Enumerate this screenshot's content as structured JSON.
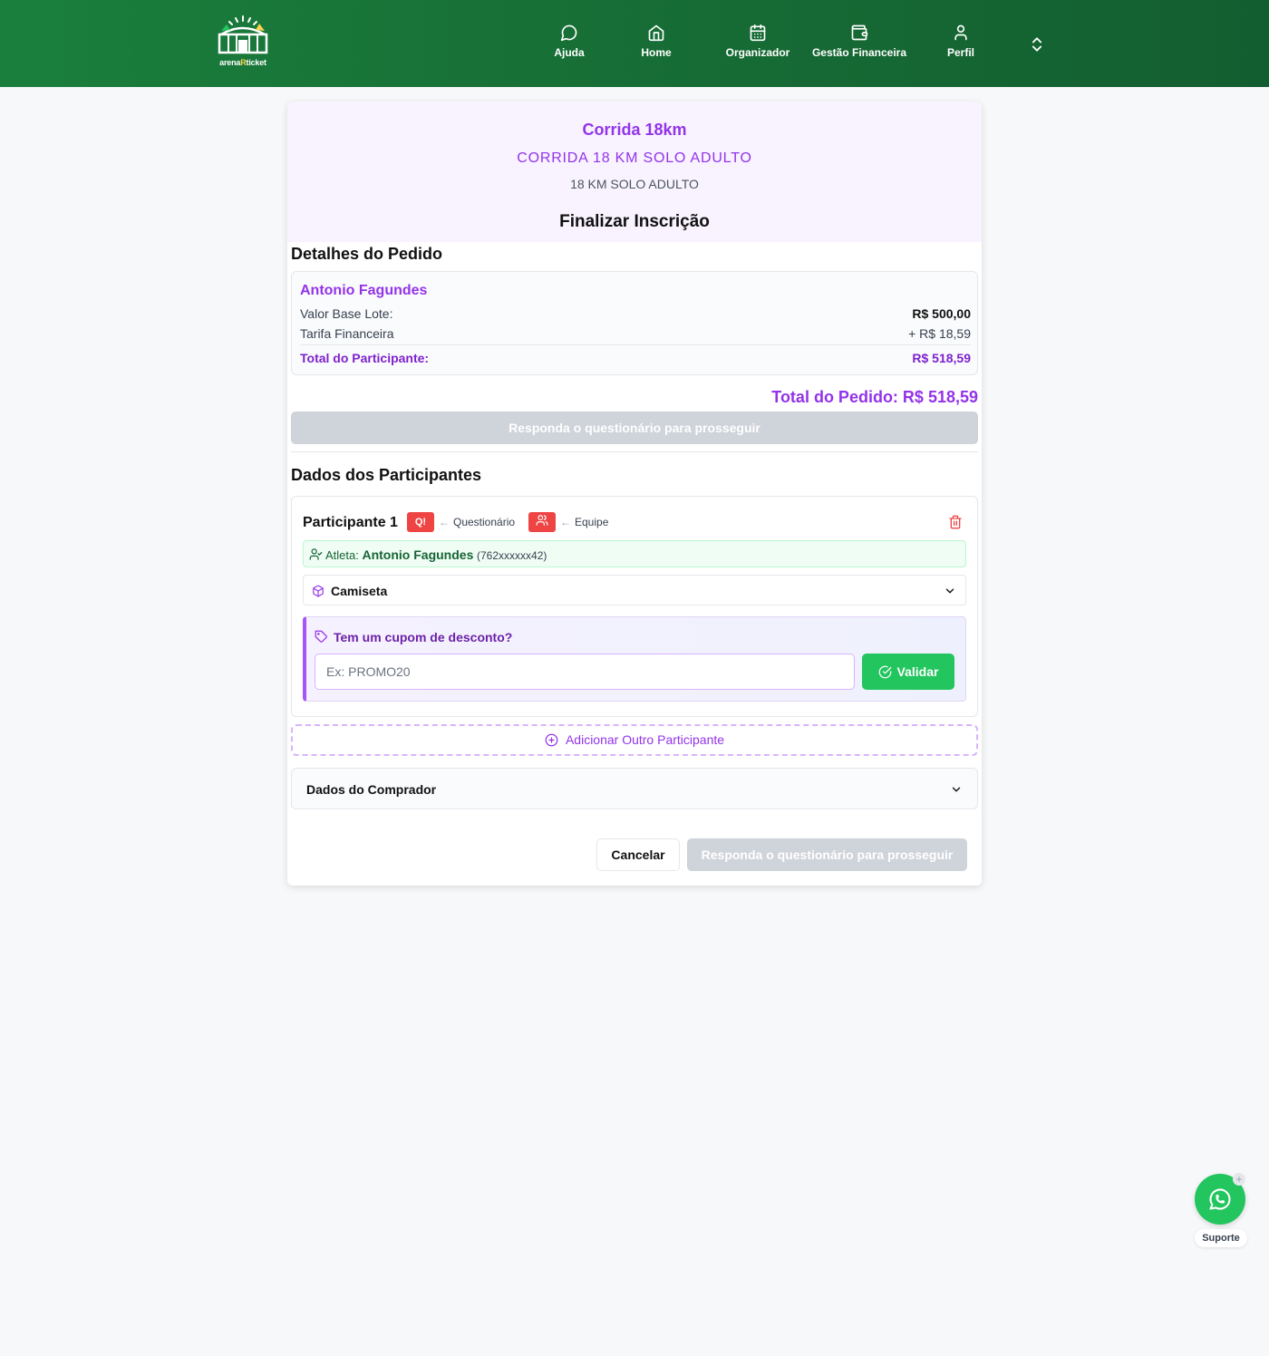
{
  "brand": {
    "logo_left": "arena",
    "logo_mid": "R",
    "logo_right": "ticket"
  },
  "nav": {
    "items": [
      {
        "label": "Ajuda",
        "icon": "chat-bubble-icon"
      },
      {
        "label": "Home",
        "icon": "home-icon"
      },
      {
        "label": "Organizador",
        "icon": "calendar-icon"
      },
      {
        "label": "Gestão Financeira",
        "icon": "wallet-icon"
      },
      {
        "label": "Perfil",
        "icon": "user-icon"
      }
    ],
    "extra_icon": "chevrons-up-down-icon"
  },
  "event": {
    "title": "Corrida 18km",
    "category": "CORRIDA 18 KM SOLO ADULTO",
    "subcategory": "18 KM SOLO ADULTO"
  },
  "page_title": "Finalizar Inscrição",
  "order": {
    "section_title": "Detalhes do Pedido",
    "participant_name": "Antonio Fagundes",
    "rows": [
      {
        "label": "Valor Base Lote:",
        "value": "R$ 500,00"
      },
      {
        "label": "Tarifa Financeira",
        "value": "+ R$ 18,59"
      }
    ],
    "participant_total_label": "Total do Participante:",
    "participant_total_value": "R$ 518,59",
    "order_total": "Total do Pedido: R$ 518,59",
    "proceed_label": "Responda o questionário para prosseguir"
  },
  "participants": {
    "section_title": "Dados dos Participantes",
    "items": [
      {
        "title": "Participante 1",
        "questionnaire_badge": "Q!",
        "questionnaire_label": "Questionário",
        "team_label": "Equipe",
        "athlete_prefix": "Atleta:",
        "athlete_name": "Antonio Fagundes",
        "athlete_doc": "(762xxxxxx42)",
        "shirt_label": "Camiseta",
        "coupon_title": "Tem um cupom de desconto?",
        "coupon_placeholder": "Ex: PROMO20",
        "coupon_value": "",
        "validate_label": "Validar"
      }
    ],
    "add_label": "Adicionar Outro Participante"
  },
  "buyer": {
    "label": "Dados do Comprador"
  },
  "footer": {
    "cancel_label": "Cancelar",
    "proceed_label": "Responda o questionário para prosseguir"
  },
  "support": {
    "label": "Suporte",
    "badge": "+"
  },
  "colors": {
    "header_green": "#1a7f3c",
    "accent_purple": "#9333ea",
    "success_green": "#22c55e",
    "alert_red": "#ef4444",
    "disabled_gray": "#cfd3da"
  }
}
